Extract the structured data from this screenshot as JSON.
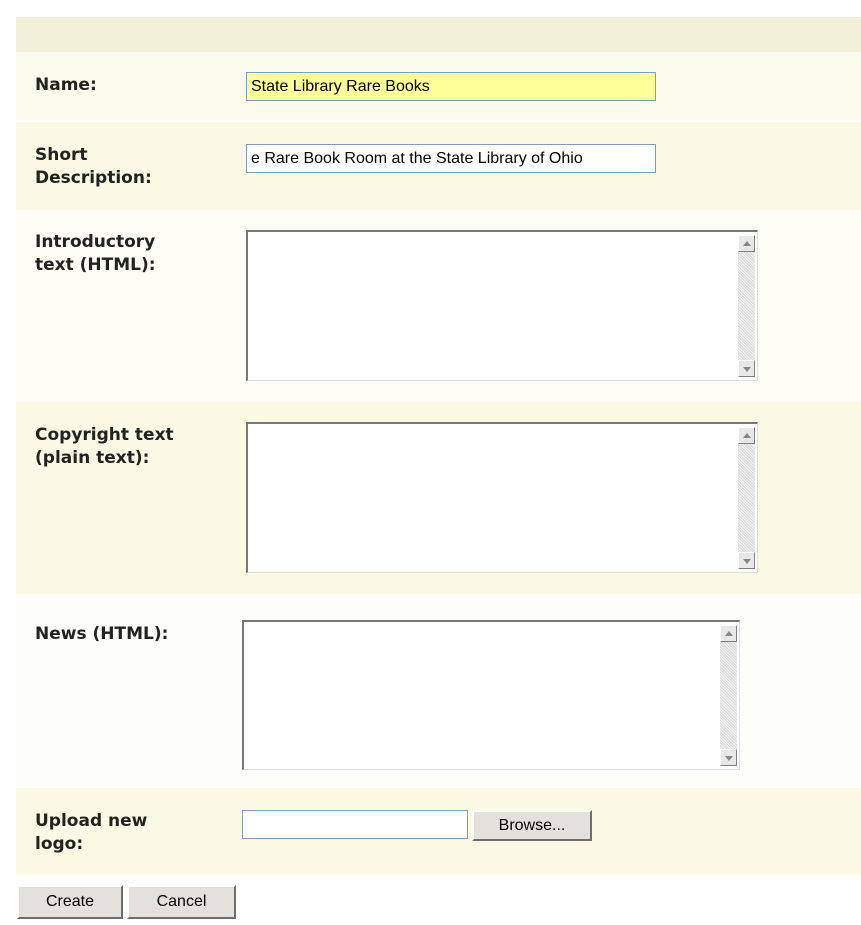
{
  "form": {
    "name_label": "Name:",
    "name_value": "State Library Rare Books",
    "short_description_label": "Short Description:",
    "short_description_value": "e Rare Book Room at the State Library of Ohio",
    "introductory_label": "Introductory text (HTML):",
    "introductory_value": "",
    "copyright_label": "Copyright text (plain text):",
    "copyright_value": "",
    "news_label": "News (HTML):",
    "news_value": "",
    "upload_label": "Upload new logo:",
    "upload_value": "",
    "browse_label": "Browse...",
    "create_label": "Create",
    "cancel_label": "Cancel"
  },
  "colors": {
    "header_band": "#f1f0d7",
    "row_band": "#fbfbec",
    "name_field_highlight": "#ffff99"
  }
}
